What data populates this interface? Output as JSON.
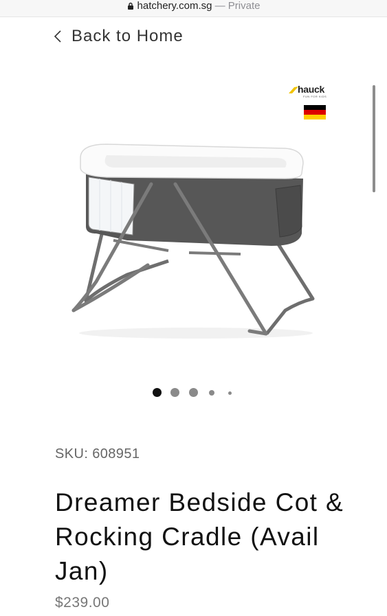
{
  "browser": {
    "domain": "hatchery.com.sg",
    "separator": " — ",
    "private_label": "Private"
  },
  "nav": {
    "back_label": "Back to Home"
  },
  "brand": {
    "name": "hauck",
    "tagline": "FUN FOR KIDS",
    "flag": "germany"
  },
  "gallery": {
    "total_images": 5,
    "active_index": 0,
    "image_subject": "grey folding bedside cot with rocking legs"
  },
  "product": {
    "sku": "SKU: 608951",
    "title": "Dreamer Bedside Cot & Rocking Cradle (Avail Jan)",
    "price": "$239.00"
  },
  "colors": {
    "text_dark": "#111111",
    "text_muted": "#777777",
    "dot_active": "#111111",
    "dot_inactive": "#8a8a8a",
    "flag": [
      "#000000",
      "#dd0000",
      "#ffce00"
    ]
  }
}
